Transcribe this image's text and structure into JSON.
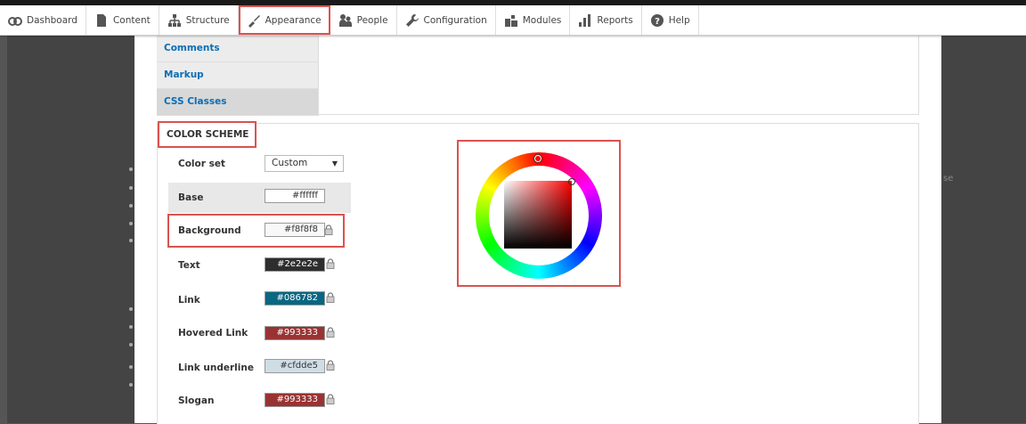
{
  "toolbar": {
    "items": [
      {
        "label": "Dashboard",
        "icon": "dashboard-icon"
      },
      {
        "label": "Content",
        "icon": "content-icon"
      },
      {
        "label": "Structure",
        "icon": "structure-icon"
      },
      {
        "label": "Appearance",
        "icon": "appearance-icon"
      },
      {
        "label": "People",
        "icon": "people-icon"
      },
      {
        "label": "Configuration",
        "icon": "wrench-icon"
      },
      {
        "label": "Modules",
        "icon": "modules-icon"
      },
      {
        "label": "Reports",
        "icon": "reports-icon"
      },
      {
        "label": "Help",
        "icon": "help-icon"
      }
    ]
  },
  "vertical_tabs": {
    "items": [
      "Comments",
      "Markup",
      "CSS Classes"
    ]
  },
  "color_scheme": {
    "legend": "COLOR SCHEME",
    "color_set_label": "Color set",
    "color_set_value": "Custom",
    "fields": [
      {
        "label": "Base",
        "value": "#ffffff",
        "bg": "#ffffff",
        "fg": "#333333"
      },
      {
        "label": "Background",
        "value": "#f8f8f8",
        "bg": "#f8f8f8",
        "fg": "#333333"
      },
      {
        "label": "Text",
        "value": "#2e2e2e",
        "bg": "#2e2e2e",
        "fg": "#ffffff"
      },
      {
        "label": "Link",
        "value": "#086782",
        "bg": "#086782",
        "fg": "#ffffff"
      },
      {
        "label": "Hovered Link",
        "value": "#993333",
        "bg": "#993333",
        "fg": "#ffffff"
      },
      {
        "label": "Link underline",
        "value": "#cfdde5",
        "bg": "#cfdde5",
        "fg": "#333333"
      },
      {
        "label": "Slogan",
        "value": "#993333",
        "bg": "#993333",
        "fg": "#ffffff"
      }
    ]
  },
  "right_fragment": "se",
  "colors": {
    "highlight": "#d9534f",
    "link": "#0a6eb4"
  }
}
